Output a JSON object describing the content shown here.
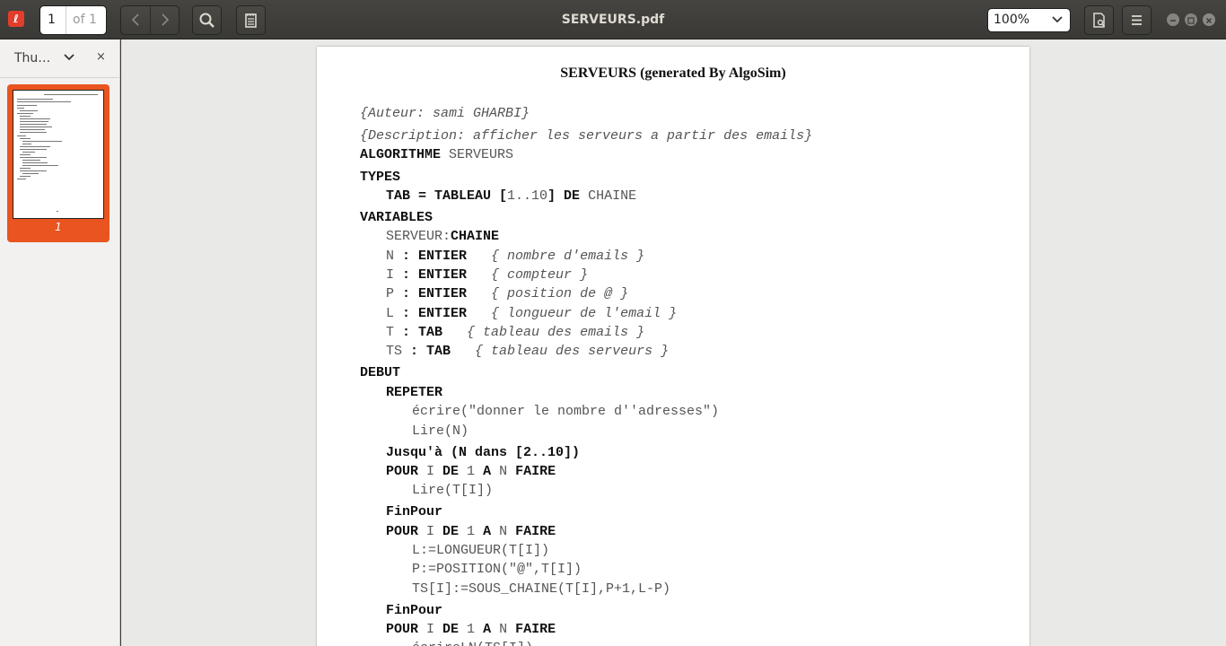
{
  "header": {
    "app_icon": "evince-icon",
    "page_number": "1",
    "page_of": "of 1",
    "title": "SERVEURS.pdf",
    "zoom": "100%"
  },
  "sidebar": {
    "label": "Thu…",
    "close": "×",
    "thumbnail_number": "1"
  },
  "document": {
    "title": "SERVEURS (generated By AlgoSim)",
    "lines": [
      {
        "indent": 0,
        "tokens": [
          {
            "s": "i",
            "t": "{Auteur: sami GHARBI}"
          }
        ]
      },
      {
        "indent": 0,
        "tokens": [
          {
            "s": "i",
            "t": "{Description: afficher les serveurs a partir des emails}"
          }
        ]
      },
      {
        "indent": 0,
        "tokens": [
          {
            "s": "b",
            "t": "ALGORITHME"
          },
          {
            "s": "n",
            "t": " SERVEURS"
          }
        ]
      },
      {
        "indent": 0,
        "tokens": [
          {
            "s": "b",
            "t": "TYPES"
          }
        ]
      },
      {
        "indent": 1,
        "tokens": [
          {
            "s": "b",
            "t": "TAB = TABLEAU ["
          },
          {
            "s": "n",
            "t": "1..10"
          },
          {
            "s": "b",
            "t": "] DE"
          },
          {
            "s": "n",
            "t": " CHAINE"
          }
        ]
      },
      {
        "indent": 0,
        "tokens": [
          {
            "s": "b",
            "t": "VARIABLES"
          }
        ]
      },
      {
        "indent": 1,
        "tokens": [
          {
            "s": "n",
            "t": "SERVEUR:"
          },
          {
            "s": "b",
            "t": "CHAINE"
          }
        ]
      },
      {
        "indent": 1,
        "tokens": [
          {
            "s": "n",
            "t": "N "
          },
          {
            "s": "b",
            "t": ": ENTIER"
          },
          {
            "s": "n",
            "t": "   "
          },
          {
            "s": "i",
            "t": "{ nombre d'emails }"
          }
        ]
      },
      {
        "indent": 1,
        "tokens": [
          {
            "s": "n",
            "t": "I "
          },
          {
            "s": "b",
            "t": ": ENTIER"
          },
          {
            "s": "n",
            "t": "   "
          },
          {
            "s": "i",
            "t": "{ compteur }"
          }
        ]
      },
      {
        "indent": 1,
        "tokens": [
          {
            "s": "n",
            "t": "P "
          },
          {
            "s": "b",
            "t": ": ENTIER"
          },
          {
            "s": "n",
            "t": "   "
          },
          {
            "s": "i",
            "t": "{ position de @ }"
          }
        ]
      },
      {
        "indent": 1,
        "tokens": [
          {
            "s": "n",
            "t": "L "
          },
          {
            "s": "b",
            "t": ": ENTIER"
          },
          {
            "s": "n",
            "t": "   "
          },
          {
            "s": "i",
            "t": "{ longueur de l'email }"
          }
        ]
      },
      {
        "indent": 1,
        "tokens": [
          {
            "s": "n",
            "t": "T "
          },
          {
            "s": "b",
            "t": ": TAB"
          },
          {
            "s": "n",
            "t": "   "
          },
          {
            "s": "i",
            "t": "{ tableau des emails }"
          }
        ]
      },
      {
        "indent": 1,
        "tokens": [
          {
            "s": "n",
            "t": "TS "
          },
          {
            "s": "b",
            "t": ": TAB"
          },
          {
            "s": "n",
            "t": "   "
          },
          {
            "s": "i",
            "t": "{ tableau des serveurs }"
          }
        ]
      },
      {
        "indent": 0,
        "tokens": [
          {
            "s": "b",
            "t": "DEBUT"
          }
        ]
      },
      {
        "indent": 1,
        "tokens": [
          {
            "s": "b",
            "t": "REPETER"
          }
        ]
      },
      {
        "indent": 2,
        "tokens": [
          {
            "s": "n",
            "t": "écrire(\"donner le nombre d''adresses\")"
          }
        ]
      },
      {
        "indent": 2,
        "tokens": [
          {
            "s": "n",
            "t": "Lire(N)"
          }
        ]
      },
      {
        "indent": 1,
        "tokens": [
          {
            "s": "b",
            "t": "Jusqu'à (N dans [2..10])"
          }
        ]
      },
      {
        "indent": 1,
        "tokens": [
          {
            "s": "b",
            "t": "POUR"
          },
          {
            "s": "n",
            "t": " I "
          },
          {
            "s": "b",
            "t": "DE"
          },
          {
            "s": "n",
            "t": " 1 "
          },
          {
            "s": "b",
            "t": "A"
          },
          {
            "s": "n",
            "t": " N "
          },
          {
            "s": "b",
            "t": "FAIRE"
          }
        ]
      },
      {
        "indent": 2,
        "tokens": [
          {
            "s": "n",
            "t": "Lire(T[I])"
          }
        ]
      },
      {
        "indent": 1,
        "tokens": [
          {
            "s": "b",
            "t": "FinPour"
          }
        ]
      },
      {
        "indent": 1,
        "tokens": [
          {
            "s": "b",
            "t": "POUR"
          },
          {
            "s": "n",
            "t": " I "
          },
          {
            "s": "b",
            "t": "DE"
          },
          {
            "s": "n",
            "t": " 1 "
          },
          {
            "s": "b",
            "t": "A"
          },
          {
            "s": "n",
            "t": " N "
          },
          {
            "s": "b",
            "t": "FAIRE"
          }
        ]
      },
      {
        "indent": 2,
        "tokens": [
          {
            "s": "n",
            "t": "L:=LONGUEUR(T[I])"
          }
        ]
      },
      {
        "indent": 2,
        "tokens": [
          {
            "s": "n",
            "t": "P:=POSITION(\"@\",T[I])"
          }
        ]
      },
      {
        "indent": 2,
        "tokens": [
          {
            "s": "n",
            "t": "TS[I]:=SOUS_CHAINE(T[I],P+1,L-P)"
          }
        ]
      },
      {
        "indent": 1,
        "tokens": [
          {
            "s": "b",
            "t": "FinPour"
          }
        ]
      },
      {
        "indent": 1,
        "tokens": [
          {
            "s": "b",
            "t": "POUR"
          },
          {
            "s": "n",
            "t": " I "
          },
          {
            "s": "b",
            "t": "DE"
          },
          {
            "s": "n",
            "t": " 1 "
          },
          {
            "s": "b",
            "t": "A"
          },
          {
            "s": "n",
            "t": " N "
          },
          {
            "s": "b",
            "t": "FAIRE"
          }
        ]
      },
      {
        "indent": 2,
        "tokens": [
          {
            "s": "n",
            "t": "écrireLN(TS[I])"
          }
        ]
      }
    ]
  },
  "colors": {
    "accent": "#e95420",
    "header_bg": "#3c3b37",
    "viewer_bg": "#e9e9e8"
  }
}
